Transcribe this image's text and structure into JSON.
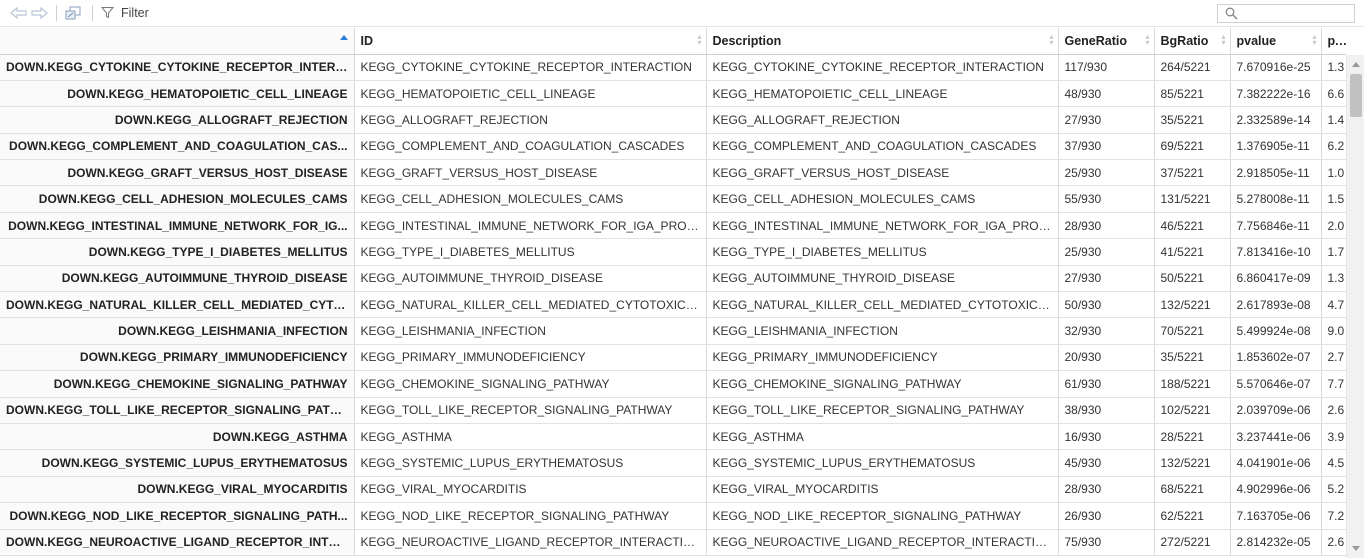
{
  "toolbar": {
    "filter_label": "Filter",
    "search_value": "",
    "icons": [
      "back-arrow-icon",
      "forward-arrow-icon",
      "open-in-window-icon",
      "filter-icon",
      "search-icon"
    ]
  },
  "table": {
    "columns": [
      "",
      "ID",
      "Description",
      "GeneRatio",
      "BgRatio",
      "pvalue",
      "p.adju"
    ],
    "sorted_column": 0,
    "sort_direction": "ascending",
    "rows": [
      {
        "name": "DOWN.KEGG_CYTOKINE_CYTOKINE_RECEPTOR_INTERA...",
        "id": "KEGG_CYTOKINE_CYTOKINE_RECEPTOR_INTERACTION",
        "desc": "KEGG_CYTOKINE_CYTOKINE_RECEPTOR_INTERACTION",
        "gr": "117/930",
        "bg": "264/5221",
        "pv": "7.670916e-25",
        "padj": "1.3"
      },
      {
        "name": "DOWN.KEGG_HEMATOPOIETIC_CELL_LINEAGE",
        "id": "KEGG_HEMATOPOIETIC_CELL_LINEAGE",
        "desc": "KEGG_HEMATOPOIETIC_CELL_LINEAGE",
        "gr": "48/930",
        "bg": "85/5221",
        "pv": "7.382222e-16",
        "padj": "6.6"
      },
      {
        "name": "DOWN.KEGG_ALLOGRAFT_REJECTION",
        "id": "KEGG_ALLOGRAFT_REJECTION",
        "desc": "KEGG_ALLOGRAFT_REJECTION",
        "gr": "27/930",
        "bg": "35/5221",
        "pv": "2.332589e-14",
        "padj": "1.4"
      },
      {
        "name": "DOWN.KEGG_COMPLEMENT_AND_COAGULATION_CAS...",
        "id": "KEGG_COMPLEMENT_AND_COAGULATION_CASCADES",
        "desc": "KEGG_COMPLEMENT_AND_COAGULATION_CASCADES",
        "gr": "37/930",
        "bg": "69/5221",
        "pv": "1.376905e-11",
        "padj": "6.2"
      },
      {
        "name": "DOWN.KEGG_GRAFT_VERSUS_HOST_DISEASE",
        "id": "KEGG_GRAFT_VERSUS_HOST_DISEASE",
        "desc": "KEGG_GRAFT_VERSUS_HOST_DISEASE",
        "gr": "25/930",
        "bg": "37/5221",
        "pv": "2.918505e-11",
        "padj": "1.0"
      },
      {
        "name": "DOWN.KEGG_CELL_ADHESION_MOLECULES_CAMS",
        "id": "KEGG_CELL_ADHESION_MOLECULES_CAMS",
        "desc": "KEGG_CELL_ADHESION_MOLECULES_CAMS",
        "gr": "55/930",
        "bg": "131/5221",
        "pv": "5.278008e-11",
        "padj": "1.5"
      },
      {
        "name": "DOWN.KEGG_INTESTINAL_IMMUNE_NETWORK_FOR_IG...",
        "id": "KEGG_INTESTINAL_IMMUNE_NETWORK_FOR_IGA_PRODUC...",
        "desc": "KEGG_INTESTINAL_IMMUNE_NETWORK_FOR_IGA_PRODUC...",
        "gr": "28/930",
        "bg": "46/5221",
        "pv": "7.756846e-11",
        "padj": "2.0"
      },
      {
        "name": "DOWN.KEGG_TYPE_I_DIABETES_MELLITUS",
        "id": "KEGG_TYPE_I_DIABETES_MELLITUS",
        "desc": "KEGG_TYPE_I_DIABETES_MELLITUS",
        "gr": "25/930",
        "bg": "41/5221",
        "pv": "7.813416e-10",
        "padj": "1.7"
      },
      {
        "name": "DOWN.KEGG_AUTOIMMUNE_THYROID_DISEASE",
        "id": "KEGG_AUTOIMMUNE_THYROID_DISEASE",
        "desc": "KEGG_AUTOIMMUNE_THYROID_DISEASE",
        "gr": "27/930",
        "bg": "50/5221",
        "pv": "6.860417e-09",
        "padj": "1.3"
      },
      {
        "name": "DOWN.KEGG_NATURAL_KILLER_CELL_MEDIATED_CYTOT...",
        "id": "KEGG_NATURAL_KILLER_CELL_MEDIATED_CYTOTOXICITY",
        "desc": "KEGG_NATURAL_KILLER_CELL_MEDIATED_CYTOTOXICITY",
        "gr": "50/930",
        "bg": "132/5221",
        "pv": "2.617893e-08",
        "padj": "4.7"
      },
      {
        "name": "DOWN.KEGG_LEISHMANIA_INFECTION",
        "id": "KEGG_LEISHMANIA_INFECTION",
        "desc": "KEGG_LEISHMANIA_INFECTION",
        "gr": "32/930",
        "bg": "70/5221",
        "pv": "5.499924e-08",
        "padj": "9.0"
      },
      {
        "name": "DOWN.KEGG_PRIMARY_IMMUNODEFICIENCY",
        "id": "KEGG_PRIMARY_IMMUNODEFICIENCY",
        "desc": "KEGG_PRIMARY_IMMUNODEFICIENCY",
        "gr": "20/930",
        "bg": "35/5221",
        "pv": "1.853602e-07",
        "padj": "2.7"
      },
      {
        "name": "DOWN.KEGG_CHEMOKINE_SIGNALING_PATHWAY",
        "id": "KEGG_CHEMOKINE_SIGNALING_PATHWAY",
        "desc": "KEGG_CHEMOKINE_SIGNALING_PATHWAY",
        "gr": "61/930",
        "bg": "188/5221",
        "pv": "5.570646e-07",
        "padj": "7.7"
      },
      {
        "name": "DOWN.KEGG_TOLL_LIKE_RECEPTOR_SIGNALING_PATH...",
        "id": "KEGG_TOLL_LIKE_RECEPTOR_SIGNALING_PATHWAY",
        "desc": "KEGG_TOLL_LIKE_RECEPTOR_SIGNALING_PATHWAY",
        "gr": "38/930",
        "bg": "102/5221",
        "pv": "2.039709e-06",
        "padj": "2.6"
      },
      {
        "name": "DOWN.KEGG_ASTHMA",
        "id": "KEGG_ASTHMA",
        "desc": "KEGG_ASTHMA",
        "gr": "16/930",
        "bg": "28/5221",
        "pv": "3.237441e-06",
        "padj": "3.9"
      },
      {
        "name": "DOWN.KEGG_SYSTEMIC_LUPUS_ERYTHEMATOSUS",
        "id": "KEGG_SYSTEMIC_LUPUS_ERYTHEMATOSUS",
        "desc": "KEGG_SYSTEMIC_LUPUS_ERYTHEMATOSUS",
        "gr": "45/930",
        "bg": "132/5221",
        "pv": "4.041901e-06",
        "padj": "4.5"
      },
      {
        "name": "DOWN.KEGG_VIRAL_MYOCARDITIS",
        "id": "KEGG_VIRAL_MYOCARDITIS",
        "desc": "KEGG_VIRAL_MYOCARDITIS",
        "gr": "28/930",
        "bg": "68/5221",
        "pv": "4.902996e-06",
        "padj": "5.2"
      },
      {
        "name": "DOWN.KEGG_NOD_LIKE_RECEPTOR_SIGNALING_PATH...",
        "id": "KEGG_NOD_LIKE_RECEPTOR_SIGNALING_PATHWAY",
        "desc": "KEGG_NOD_LIKE_RECEPTOR_SIGNALING_PATHWAY",
        "gr": "26/930",
        "bg": "62/5221",
        "pv": "7.163705e-06",
        "padj": "7.2"
      },
      {
        "name": "DOWN.KEGG_NEUROACTIVE_LIGAND_RECEPTOR_INTER...",
        "id": "KEGG_NEUROACTIVE_LIGAND_RECEPTOR_INTERACTION",
        "desc": "KEGG_NEUROACTIVE_LIGAND_RECEPTOR_INTERACTION",
        "gr": "75/930",
        "bg": "272/5221",
        "pv": "2.814232e-05",
        "padj": "2.6"
      }
    ]
  },
  "colors": {
    "sort_active": "#2b7bdb",
    "row_header_bg": "#fafafa",
    "grid_line": "#dadada"
  }
}
